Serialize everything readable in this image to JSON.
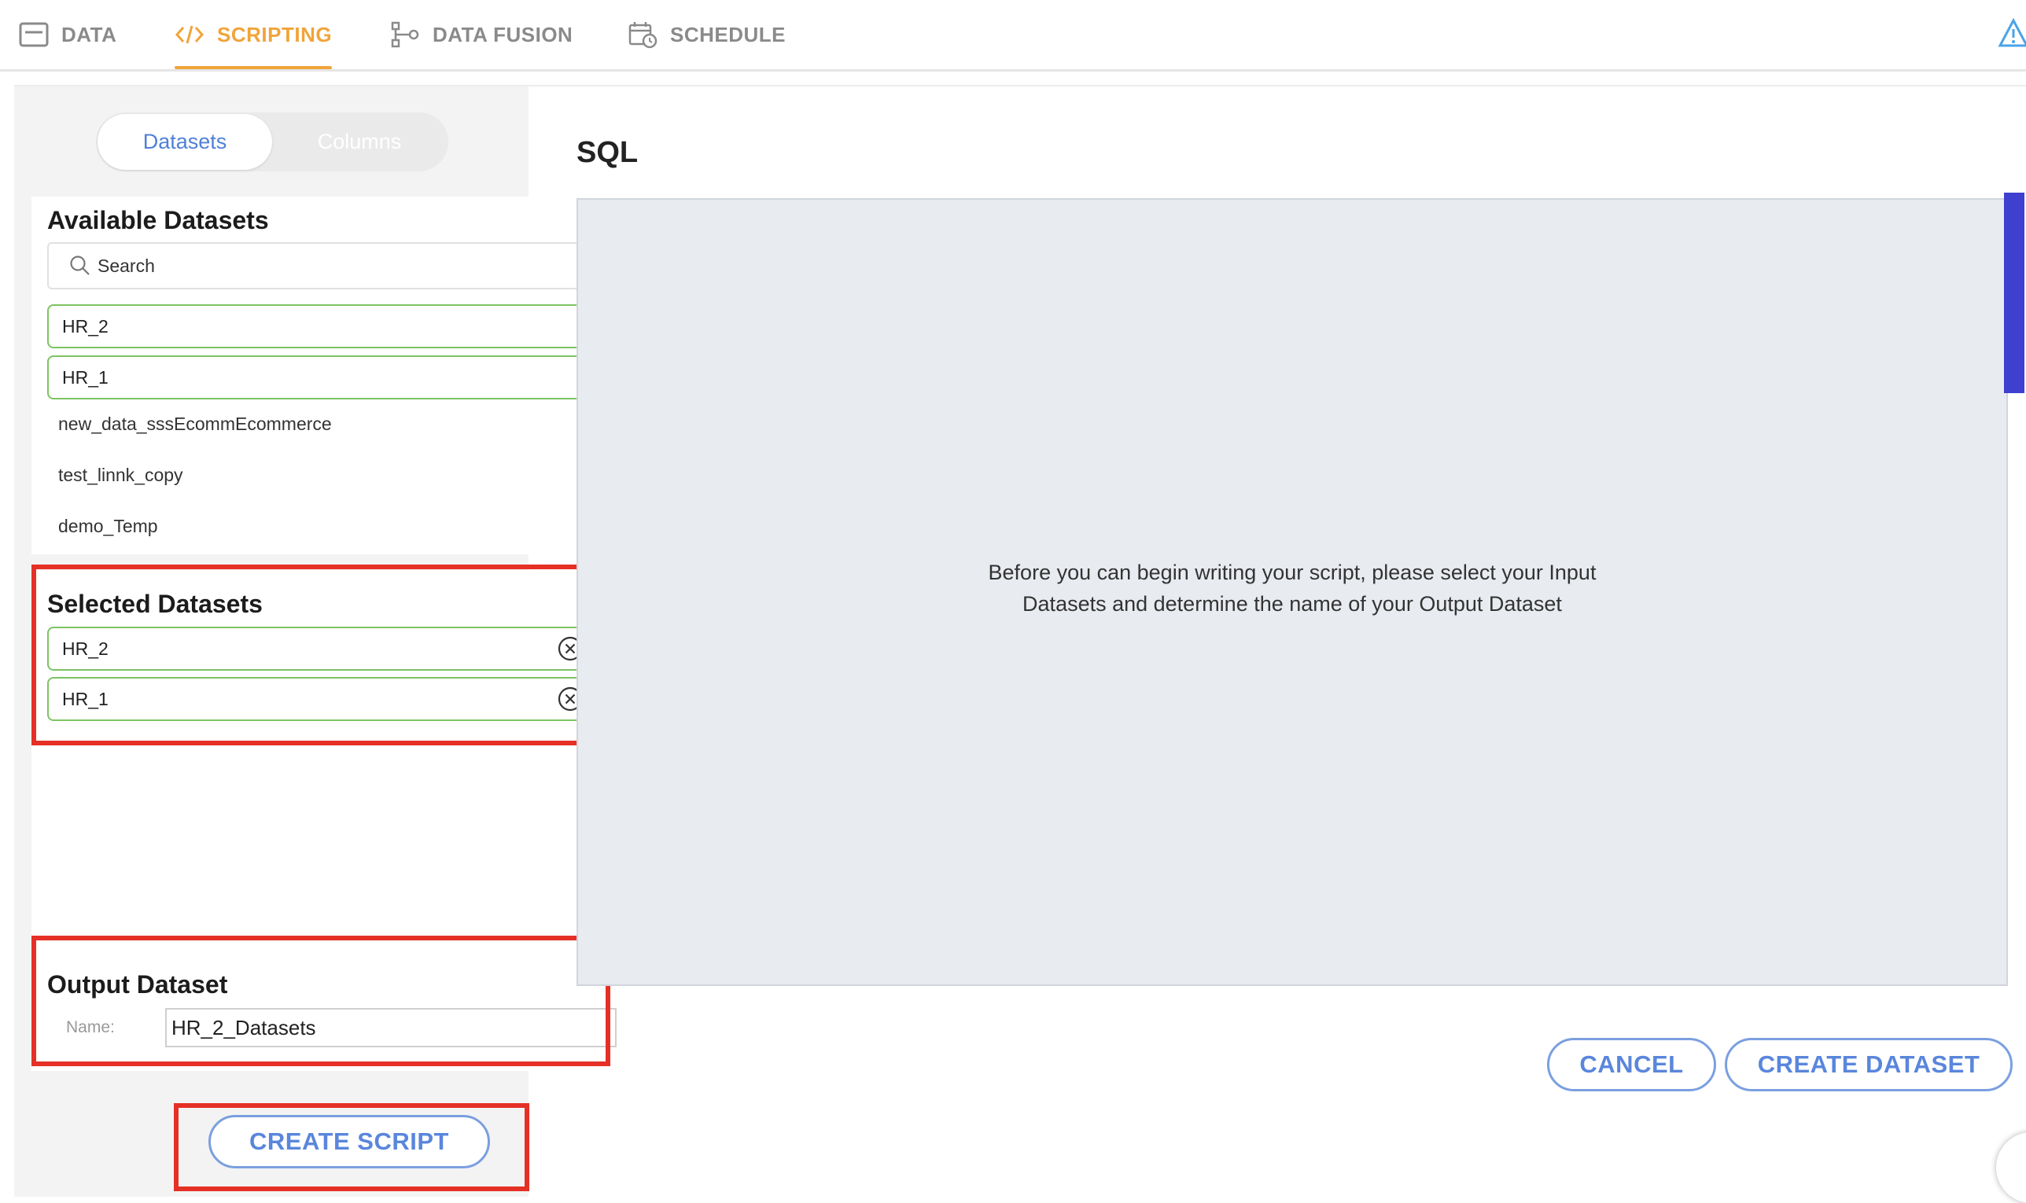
{
  "nav": {
    "tabs": [
      {
        "label": "DATA",
        "icon": "table-icon"
      },
      {
        "label": "SCRIPTING",
        "icon": "code-icon",
        "active": true
      },
      {
        "label": "DATA FUSION",
        "icon": "flow-icon"
      },
      {
        "label": "SCHEDULE",
        "icon": "calendar-clock-icon"
      }
    ],
    "right_icon": "warning-icon"
  },
  "left": {
    "toggle": {
      "datasets": "Datasets",
      "columns": "Columns"
    },
    "available": {
      "title": "Available Datasets",
      "search_placeholder": "Search",
      "items": [
        "HR_2",
        "HR_1",
        "new_data_sssEcommEcommerce",
        "test_linnk_copy",
        "demo_Temp"
      ],
      "selected_highlight": [
        "HR_2",
        "HR_1"
      ]
    },
    "selected": {
      "title": "Selected Datasets",
      "items": [
        "HR_2",
        "HR_1"
      ]
    },
    "output": {
      "title": "Output Dataset",
      "name_label": "Name:",
      "name_value": "HR_2_Datasets"
    },
    "create_script_label": "CREATE SCRIPT"
  },
  "right": {
    "title": "SQL",
    "editor_message": "Before you can begin writing your script, please select your Input Datasets and determine the name of your Output Dataset",
    "cancel_label": "CANCEL",
    "create_dataset_label": "CREATE DATASET"
  },
  "colors": {
    "accent_orange": "#f0a43b",
    "button_blue": "#5a86dc",
    "chip_green": "#7cc463",
    "annotation_red": "#e53026",
    "scrollbar": "#3f3fd0"
  }
}
